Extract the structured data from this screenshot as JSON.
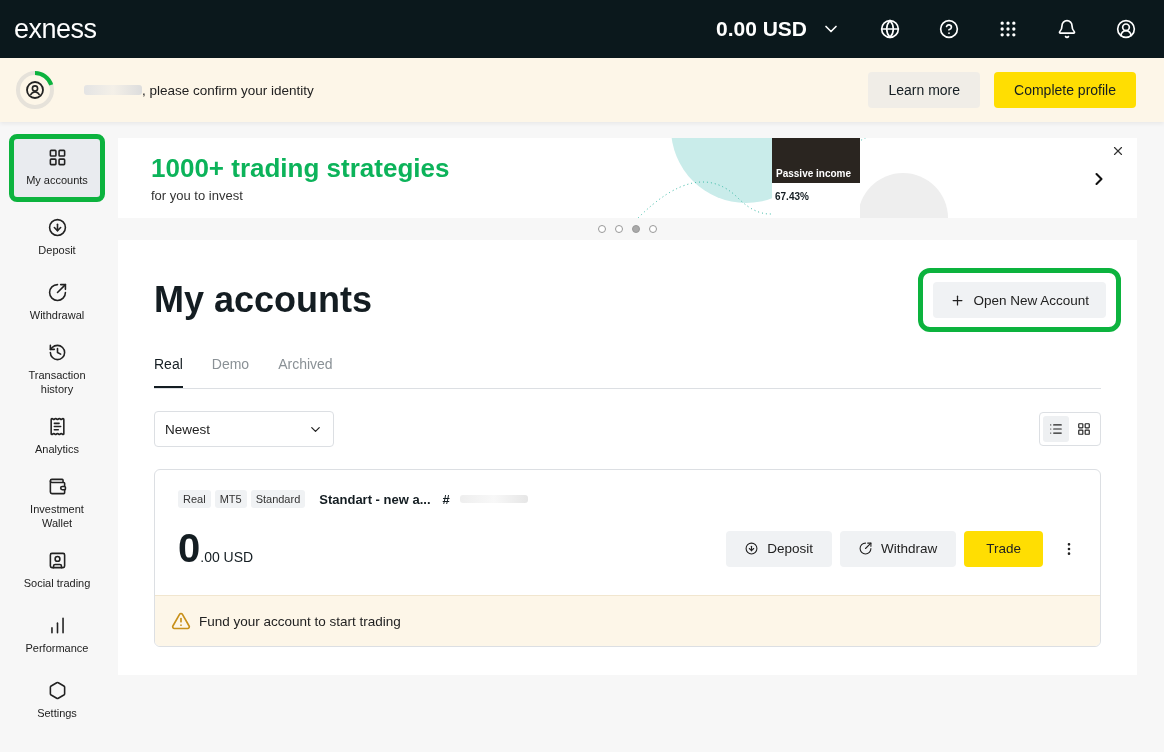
{
  "header": {
    "logo": "exness",
    "balance": "0.00 USD"
  },
  "notice": {
    "level": 0.2,
    "message": ", please confirm your identity",
    "buttons": [
      {
        "label": "Learn more",
        "kind": "secondary"
      },
      {
        "label": "Complete profile",
        "kind": "primary"
      }
    ]
  },
  "sidebar": {
    "items": [
      {
        "label": "My accounts",
        "selected": true,
        "highlighted": true
      },
      {
        "label": "Deposit",
        "selected": false,
        "highlighted": false
      },
      {
        "label": "Withdrawal",
        "selected": false,
        "highlighted": false
      },
      {
        "label": "Transaction history",
        "selected": false,
        "highlighted": false
      },
      {
        "label": "Analytics",
        "selected": false,
        "highlighted": false
      },
      {
        "label": "Investment Wallet",
        "selected": false,
        "highlighted": false
      },
      {
        "label": "Social trading",
        "selected": false,
        "highlighted": false
      },
      {
        "label": "Performance",
        "selected": false,
        "highlighted": false
      },
      {
        "label": "Settings",
        "selected": false,
        "highlighted": false
      }
    ]
  },
  "promo": {
    "title": "1000+ trading strategies",
    "subtitle": "for you to invest",
    "card": {
      "heading": "Passive income",
      "return_value": "67.43%"
    },
    "dots": [
      {
        "selected": false
      },
      {
        "selected": false
      },
      {
        "selected": true
      },
      {
        "selected": false
      }
    ]
  },
  "accounts": {
    "title": "My accounts",
    "open_button": "Open New Account",
    "open_highlighted": true,
    "tabs": [
      {
        "label": "Real",
        "selected": true
      },
      {
        "label": "Demo",
        "selected": false
      },
      {
        "label": "Archived",
        "selected": false
      }
    ],
    "sort": "Newest",
    "views": [
      {
        "selected": true
      },
      {
        "selected": false
      }
    ],
    "card": {
      "tags": [
        "Real",
        "MT5",
        "Standard"
      ],
      "name": "Standart - new a...",
      "number_prefix": "#",
      "balance_main": "0",
      "balance_rest": ".00 USD",
      "actions": [
        {
          "label": "Deposit",
          "kind": "deposit"
        },
        {
          "label": "Withdraw",
          "kind": "withdraw"
        },
        {
          "label": "Trade",
          "kind": "trade"
        }
      ],
      "warning": "Fund your account to start trading"
    }
  }
}
